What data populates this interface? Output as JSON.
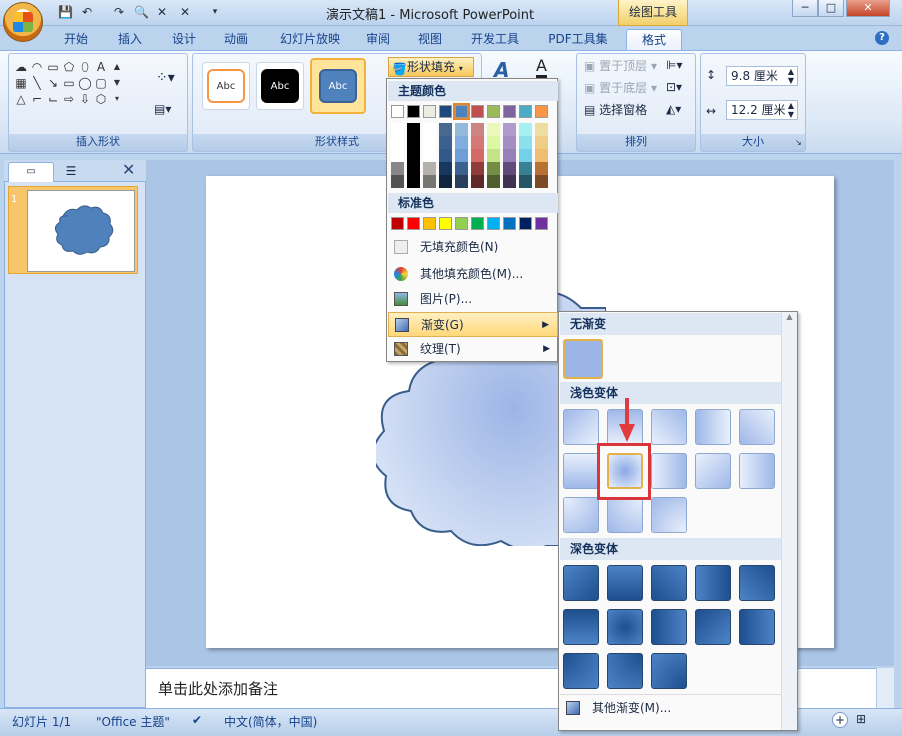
{
  "titlebar": {
    "title": "演示文稿1 - Microsoft PowerPoint",
    "context_tab": "绘图工具",
    "qat_icons": [
      "save-icon",
      "undo-icon",
      "redo-icon",
      "print-preview-icon",
      "close-doc-icon",
      "customize-icon"
    ]
  },
  "tabs": [
    "开始",
    "插入",
    "设计",
    "动画",
    "幻灯片放映",
    "审阅",
    "视图",
    "开发工具",
    "PDF工具集",
    "格式"
  ],
  "ribbon": {
    "insert_shapes_label": "插入形状",
    "shape_styles_label": "形状样式",
    "style_thumbs": [
      "Abc",
      "Abc",
      "Abc"
    ],
    "fill_button": "形状填充",
    "arrange_label": "排列",
    "arrange_items": [
      "置于顶层",
      "置于底层",
      "选择窗格"
    ],
    "size_label": "大小",
    "height": "9.8 厘米",
    "width": "12.2 厘米"
  },
  "fill_menu": {
    "theme_colors_title": "主题颜色",
    "standard_colors_title": "标准色",
    "theme_colors": [
      "#ffffff",
      "#000000",
      "#eeece1",
      "#1f497d",
      "#4f81bd",
      "#c0504d",
      "#9bbb59",
      "#8064a2",
      "#4bacc6",
      "#f79646"
    ],
    "standard_colors": [
      "#c00000",
      "#ff0000",
      "#ffc000",
      "#ffff00",
      "#92d050",
      "#00b050",
      "#00b0f0",
      "#0070c0",
      "#002060",
      "#7030a0"
    ],
    "no_fill": "无填充颜色(N)",
    "more_colors": "其他填充颜色(M)...",
    "picture": "图片(P)...",
    "gradient": "渐变(G)",
    "texture": "纹理(T)"
  },
  "gradient_menu": {
    "no_gradient": "无渐变",
    "light_variations": "浅色变体",
    "dark_variations": "深色变体",
    "more_gradients": "其他渐变(M)..."
  },
  "notes": {
    "placeholder": "单击此处添加备注"
  },
  "statusbar": {
    "slide_counter": "幻灯片 1/1",
    "theme": "\"Office 主题\"",
    "language": "中文(简体，中国)"
  },
  "slide_panel": {
    "slide_number": "1"
  }
}
